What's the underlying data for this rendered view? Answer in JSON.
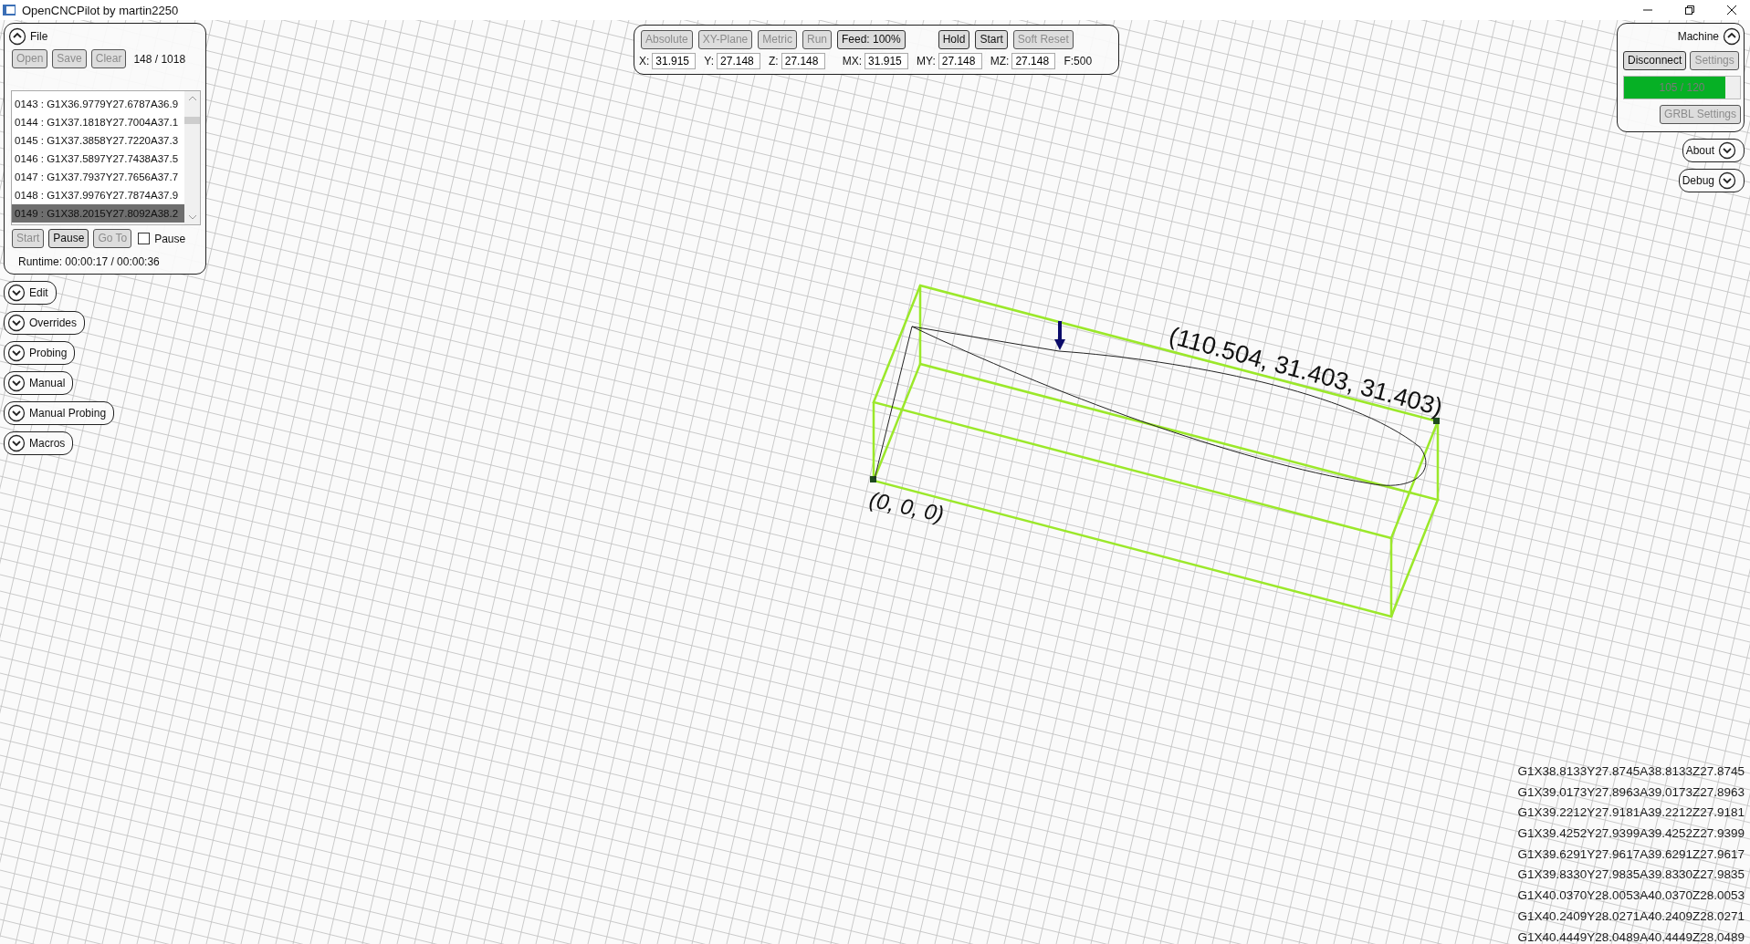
{
  "window": {
    "title": "OpenCNCPilot by martin2250"
  },
  "file_panel": {
    "title": "File",
    "expanded": true,
    "buttons": [
      {
        "label": "Open",
        "disabled": true
      },
      {
        "label": "Save",
        "disabled": true
      },
      {
        "label": "Clear",
        "disabled": true
      }
    ],
    "line_count": "148 / 1018",
    "code_lines": [
      {
        "text": "0143 : G1X36.9779Y27.6787A36.9",
        "selected": false
      },
      {
        "text": "0144 : G1X37.1818Y27.7004A37.1",
        "selected": false
      },
      {
        "text": "0145 : G1X37.3858Y27.7220A37.3",
        "selected": false
      },
      {
        "text": "0146 : G1X37.5897Y27.7438A37.5",
        "selected": false
      },
      {
        "text": "0147 : G1X37.7937Y27.7656A37.7",
        "selected": false
      },
      {
        "text": "0148 : G1X37.9976Y27.7874A37.9",
        "selected": false
      },
      {
        "text": "0149 : G1X38.2015Y27.8092A38.2",
        "selected": true
      }
    ],
    "run_buttons": [
      {
        "label": "Start",
        "disabled": true
      },
      {
        "label": "Pause",
        "disabled": false
      },
      {
        "label": "Go To",
        "disabled": true
      }
    ],
    "pause_checkbox": {
      "label": "Pause",
      "checked": false
    },
    "runtime": "Runtime: 00:00:17 / 00:00:36"
  },
  "left_panels": [
    {
      "title": "Edit",
      "expanded": false
    },
    {
      "title": "Overrides",
      "expanded": false
    },
    {
      "title": "Probing",
      "expanded": false
    },
    {
      "title": "Manual",
      "expanded": false
    },
    {
      "title": "Manual Probing",
      "expanded": false
    },
    {
      "title": "Macros",
      "expanded": false
    }
  ],
  "toolbar": {
    "buttons": [
      {
        "label": "Absolute",
        "disabled": true
      },
      {
        "label": "XY-Plane",
        "disabled": true
      },
      {
        "label": "Metric",
        "disabled": true
      },
      {
        "label": "Run",
        "disabled": true
      },
      {
        "label": "Feed: 100%",
        "disabled": false
      },
      {
        "label": "Hold",
        "disabled": false
      },
      {
        "label": "Start",
        "disabled": false
      },
      {
        "label": "Soft Reset",
        "disabled": true
      }
    ],
    "fields": [
      {
        "label": "X:",
        "value": "31.915"
      },
      {
        "label": "Y:",
        "value": "27.148"
      },
      {
        "label": "Z:",
        "value": "27.148"
      },
      {
        "label": "MX:",
        "value": "31.915"
      },
      {
        "label": "MY:",
        "value": "27.148"
      },
      {
        "label": "MZ:",
        "value": "27.148"
      }
    ],
    "feed": "F:500"
  },
  "machine_panel": {
    "title": "Machine",
    "expanded": true,
    "buttons": [
      {
        "label": "Disconnect",
        "disabled": false
      },
      {
        "label": "Settings",
        "disabled": true
      }
    ],
    "buffer": {
      "level": 0.875,
      "reading": "105 / 120"
    },
    "grbl_button": {
      "label": "GRBL Settings",
      "disabled": true
    }
  },
  "right_panels": [
    {
      "title": "About",
      "expanded": false
    },
    {
      "title": "Debug",
      "expanded": false
    }
  ],
  "viewport": {
    "max_label": "(110.504, 31.403, 31.403)",
    "origin_label": "(0, 0, 0)"
  },
  "console_lines": [
    "G1X38.8133Y27.8745A38.8133Z27.8745",
    "G1X39.0173Y27.8963A39.0173Z27.8963",
    "G1X39.2212Y27.9181A39.2212Z27.9181",
    "G1X39.4252Y27.9399A39.4252Z27.9399",
    "G1X39.6291Y27.9617A39.6291Z27.9617",
    "G1X39.8330Y27.9835A39.8330Z27.9835",
    "G1X40.0370Y28.0053A40.0370Z28.0053",
    "G1X40.2409Y28.0271A40.2409Z28.0271",
    "G1X40.4449Y28.0489A40.4449Z28.0489"
  ]
}
